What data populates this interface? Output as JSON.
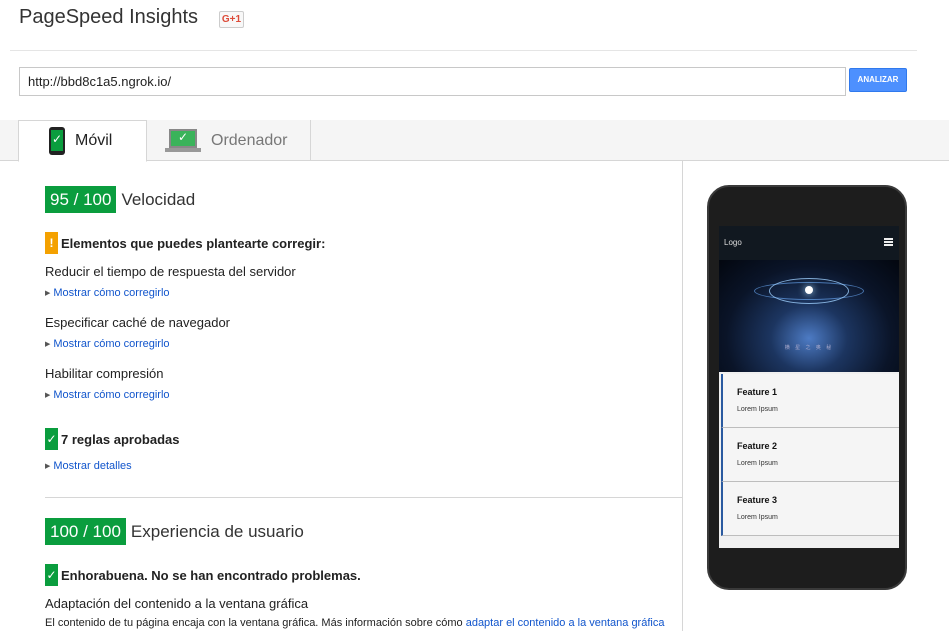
{
  "header": {
    "title": "PageSpeed Insights",
    "gplus_label": "G+1"
  },
  "search": {
    "value": "http://bbd8c1a5.ngrok.io/",
    "button_label": "ANALIZAR"
  },
  "tabs": [
    {
      "label": "Móvil",
      "active": true,
      "icon": "mobile-phone-check-icon"
    },
    {
      "label": "Ordenador",
      "active": false,
      "icon": "laptop-check-icon"
    }
  ],
  "speed": {
    "score": "95 / 100",
    "label": "Velocidad",
    "warn_heading": "Elementos que puedes plantearte corregir:",
    "warn_icon": "!",
    "rules": [
      {
        "title": "Reducir el tiempo de respuesta del servidor",
        "link": "Mostrar cómo corregirlo"
      },
      {
        "title": "Especificar caché de navegador",
        "link": "Mostrar cómo corregirlo"
      },
      {
        "title": "Habilitar compresión",
        "link": "Mostrar cómo corregirlo"
      }
    ],
    "passed_heading": "7 reglas aprobadas",
    "passed_link": "Mostrar detalles"
  },
  "ux": {
    "score": "100 / 100",
    "label": "Experiencia de usuario",
    "ok_heading": "Enhorabuena. No se han encontrado problemas.",
    "rule_title": "Adaptación del contenido a la ventana gráfica",
    "desc_prefix": "El contenido de tu página encaja con la ventana gráfica. Más información sobre cómo",
    "desc_link": "adaptar el contenido a la ventana gráfica"
  },
  "check_glyph": "✓",
  "preview": {
    "logo": "Logo",
    "hero_text": "横 星 之 奥 秘",
    "features": [
      {
        "title": "Feature 1",
        "text": "Lorem Ipsum"
      },
      {
        "title": "Feature 2",
        "text": "Lorem Ipsum"
      },
      {
        "title": "Feature 3",
        "text": "Lorem Ipsum"
      }
    ]
  },
  "colors": {
    "good": "#0a9d3e",
    "warn": "#f4a100",
    "link": "#1155cc",
    "button": "#4d90fe"
  }
}
